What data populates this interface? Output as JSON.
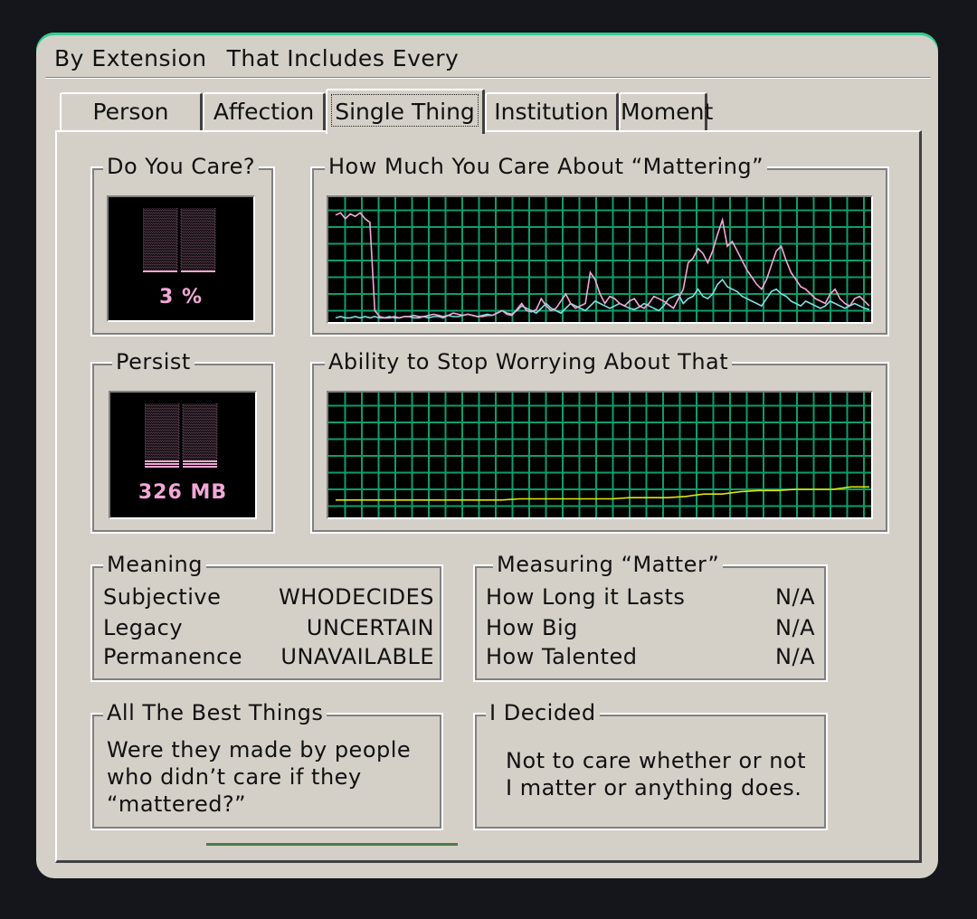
{
  "menu": {
    "item1": "By Extension",
    "item2": "That Includes Every"
  },
  "tabs": [
    "Person",
    "Affection",
    "Single Thing",
    "Institution",
    "Moment"
  ],
  "active_tab": "Single Thing",
  "care_meter": {
    "title": "Do You Care?",
    "value_label": "3 %",
    "level": 0.03
  },
  "persist_meter": {
    "title": "Persist",
    "value_label": "326 MB",
    "level": 0.12
  },
  "mattering_graph": {
    "title": "How Much You Care About “Mattering”"
  },
  "worry_graph": {
    "title": "Ability to Stop Worrying About That"
  },
  "colors": {
    "meter_pink": "#f2a8d6",
    "grid_green": "#0b9e6a",
    "series_pink": "#f2a8d6",
    "series_cyan": "#7fe0e0",
    "series_yellow": "#e6e600",
    "accent_top": "#2fcf93"
  },
  "meaning": {
    "title": "Meaning",
    "rows": [
      {
        "label": "Subjective",
        "value": "WHODECIDES"
      },
      {
        "label": "Legacy",
        "value": "UNCERTAIN"
      },
      {
        "label": "Permanence",
        "value": "UNAVAILABLE"
      }
    ]
  },
  "measuring": {
    "title": "Measuring “Matter”",
    "rows": [
      {
        "label": "How Long it Lasts",
        "value": "N/A"
      },
      {
        "label": "How Big",
        "value": "N/A"
      },
      {
        "label": "How Talented",
        "value": "N/A"
      }
    ]
  },
  "best_things": {
    "title": "All The Best Things",
    "lines": [
      "Were they made by people",
      "who didn’t care if they",
      "“mattered?”"
    ]
  },
  "decided": {
    "title": "I Decided",
    "lines": [
      "Not to care whether or not",
      "I matter or anything does."
    ]
  },
  "chart_data": [
    {
      "type": "line",
      "title": "How Much You Care About “Mattering”",
      "ylim": [
        0,
        100
      ],
      "grid": true,
      "series": [
        {
          "values": [
            88,
            90,
            85,
            89,
            87,
            90,
            85,
            82,
            8,
            3,
            2,
            2,
            3,
            2,
            3,
            3,
            4,
            3,
            3,
            4,
            5,
            4,
            3,
            4,
            6,
            5,
            4,
            5,
            4,
            3,
            3,
            4,
            4,
            6,
            8,
            5,
            4,
            9,
            14,
            8,
            7,
            9,
            18,
            12,
            8,
            10,
            16,
            22,
            14,
            10,
            12,
            14,
            40,
            34,
            22,
            14,
            20,
            18,
            14,
            12,
            16,
            18,
            12,
            10,
            14,
            20,
            18,
            16,
            13,
            10,
            18,
            26,
            48,
            52,
            60,
            56,
            48,
            58,
            72,
            84,
            62,
            66,
            58,
            50,
            42,
            36,
            30,
            26,
            34,
            46,
            58,
            62,
            50,
            40,
            34,
            28,
            26,
            22,
            18,
            16,
            14,
            22,
            26,
            18,
            14,
            12,
            18,
            20,
            16,
            12
          ]
        },
        {
          "values": [
            2,
            3,
            2,
            2,
            3,
            2,
            3,
            2,
            3,
            2,
            2,
            3,
            2,
            2,
            3,
            3,
            2,
            2,
            3,
            2,
            3,
            3,
            2,
            4,
            3,
            3,
            4,
            5,
            4,
            3,
            4,
            5,
            4,
            6,
            8,
            6,
            5,
            8,
            12,
            10,
            8,
            6,
            10,
            14,
            10,
            8,
            6,
            10,
            14,
            12,
            10,
            8,
            12,
            16,
            14,
            12,
            10,
            12,
            14,
            12,
            10,
            9,
            11,
            14,
            12,
            10,
            8,
            12,
            18,
            20,
            22,
            14,
            18,
            20,
            26,
            20,
            18,
            22,
            30,
            34,
            28,
            26,
            24,
            20,
            18,
            16,
            14,
            12,
            18,
            24,
            26,
            22,
            20,
            16,
            14,
            12,
            16,
            14,
            12,
            10,
            12,
            16,
            14,
            12,
            10,
            12,
            14,
            12,
            10,
            9
          ]
        }
      ]
    },
    {
      "type": "line",
      "title": "Ability to Stop Worrying About That",
      "ylim": [
        0,
        100
      ],
      "grid": true,
      "series": [
        {
          "values": [
            13,
            13,
            13,
            13,
            13,
            13,
            13,
            13,
            13,
            13,
            14,
            14,
            14,
            14,
            14,
            14,
            15,
            15,
            15,
            16,
            18,
            18,
            20,
            21,
            21,
            22,
            22,
            22,
            24,
            24
          ]
        }
      ]
    }
  ]
}
